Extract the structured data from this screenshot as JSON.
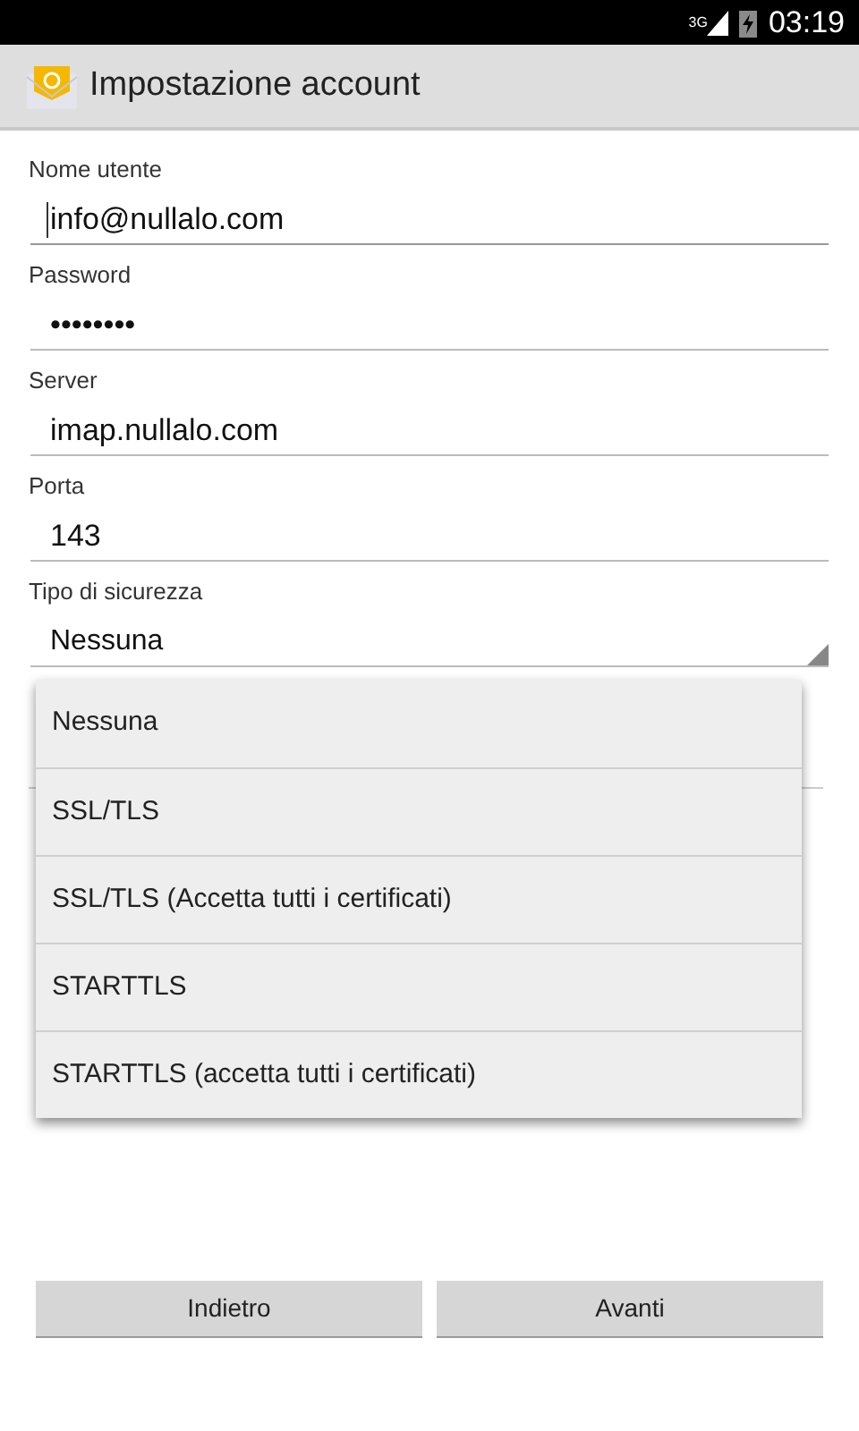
{
  "status_bar": {
    "network": "3G",
    "time": "03:19"
  },
  "app_bar": {
    "title": "Impostazione account"
  },
  "fields": [
    {
      "label": "Nome utente",
      "value": "info@nullalo.com",
      "focused": true
    },
    {
      "label": "Password",
      "value": "••••••••",
      "focused": false
    },
    {
      "label": "Server",
      "value": "imap.nullalo.com",
      "focused": false
    },
    {
      "label": "Porta",
      "value": "143",
      "focused": false
    }
  ],
  "security": {
    "label": "Tipo di sicurezza",
    "value": "Nessuna"
  },
  "dropdown": {
    "options": [
      {
        "label": "Nessuna"
      },
      {
        "label": "SSL/TLS"
      },
      {
        "label": "SSL/TLS (Accetta tutti i certificati)"
      },
      {
        "label": "STARTTLS"
      },
      {
        "label": "STARTTLS (accetta tutti i certificati)"
      }
    ]
  },
  "buttons": [
    {
      "label": "Indietro"
    },
    {
      "label": "Avanti"
    }
  ]
}
